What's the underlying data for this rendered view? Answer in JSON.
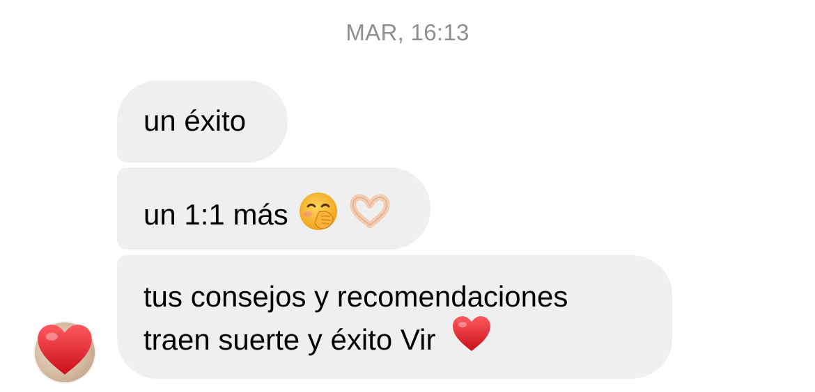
{
  "timestamp": "MAR, 16:13",
  "messages": [
    {
      "text": "un éxito"
    },
    {
      "text": "un 1:1 más",
      "emojis": [
        "hand-over-mouth-face",
        "heart-hands"
      ]
    },
    {
      "text": "tus consejos y recomendaciones\ntraen suerte y éxito Vir",
      "emoji": "red-heart"
    }
  ],
  "avatar": {
    "reaction": "red-heart"
  },
  "colors": {
    "bubble": "#efefef",
    "timestamp": "#8e8e93",
    "heart": "#e0161e"
  }
}
